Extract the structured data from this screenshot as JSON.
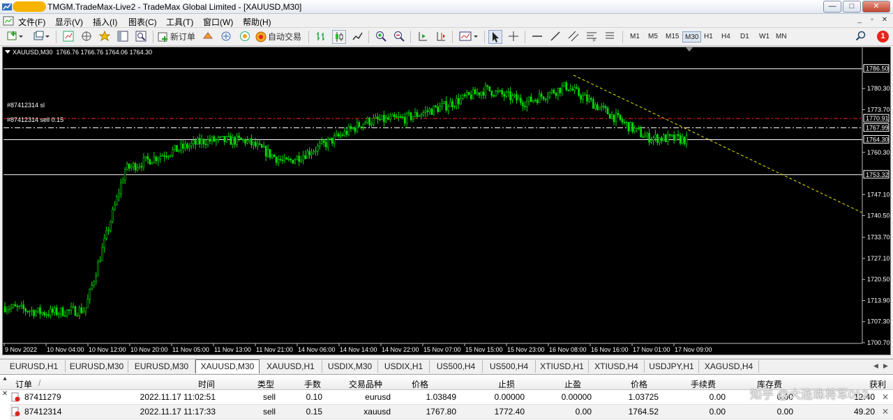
{
  "window": {
    "title": "TMGM.TradeMax-Live2 - TradeMax Global Limited - [XAUUSD,M30]",
    "controls": {
      "minimize": "—",
      "maximize": "□",
      "close": "✕"
    }
  },
  "menu": {
    "items": [
      "文件(F)",
      "显示(V)",
      "插入(I)",
      "图表(C)",
      "工具(T)",
      "窗口(W)",
      "帮助(H)"
    ],
    "mdi": {
      "minimize": "_",
      "restore": "▫",
      "close": "✕"
    }
  },
  "toolbar": {
    "new_order": "新订单",
    "auto_trade": "自动交易",
    "timeframes": [
      "M1",
      "M5",
      "M15",
      "M30",
      "H1",
      "H4",
      "D1",
      "W1",
      "MN"
    ],
    "active_timeframe": "M30",
    "notification_count": "1"
  },
  "chart": {
    "header": "XAUUSD,M30  1766.76 1766.76 1764.06 1764.30",
    "order_lines": [
      "#87412314 sl",
      "#87412314 sell 0.15"
    ],
    "price_labels": [
      "1786.50",
      "1770.91",
      "1767.99",
      "1764.30",
      "1753.32"
    ],
    "price_axis": [
      "1786.50",
      "1780.30",
      "1773.70",
      "1770.91",
      "1767.99",
      "1764.30",
      "1760.30",
      "1753.32",
      "1747.10",
      "1740.50",
      "1733.70",
      "1727.10",
      "1720.50",
      "1713.90",
      "1707.30",
      "1700.70"
    ],
    "time_axis": [
      "9 Nov 2022",
      "10 Nov 04:00",
      "10 Nov 12:00",
      "10 Nov 20:00",
      "11 Nov 05:00",
      "11 Nov 13:00",
      "11 Nov 21:00",
      "14 Nov 06:00",
      "14 Nov 14:00",
      "14 Nov 22:00",
      "15 Nov 07:00",
      "15 Nov 15:00",
      "15 Nov 23:00",
      "16 Nov 08:00",
      "16 Nov 16:00",
      "17 Nov 01:00",
      "17 Nov 09:00"
    ],
    "colors": {
      "candle": "#00dd00",
      "sl_line": "#ff2020",
      "trend_line": "#e6e600",
      "background": "#000000",
      "grid_text": "#ffffff"
    }
  },
  "chart_data": {
    "type": "line",
    "title": "XAUUSD,M30",
    "xlabel": "",
    "ylabel": "",
    "ylim": [
      1700.7,
      1789.5
    ],
    "x": [
      "9 Nov 2022",
      "10 Nov 04:00",
      "10 Nov 12:00",
      "10 Nov 20:00",
      "11 Nov 05:00",
      "11 Nov 13:00",
      "11 Nov 21:00",
      "14 Nov 06:00",
      "14 Nov 14:00",
      "14 Nov 22:00",
      "15 Nov 07:00",
      "15 Nov 15:00",
      "15 Nov 23:00",
      "16 Nov 08:00",
      "16 Nov 16:00",
      "17 Nov 01:00",
      "17 Nov 09:00"
    ],
    "series": [
      {
        "name": "XAUUSD,M30",
        "values": [
          1712,
          1710,
          1711,
          1755,
          1760,
          1764,
          1764,
          1757,
          1763,
          1770,
          1771,
          1775,
          1780,
          1776,
          1781,
          1773,
          1765,
          1764.3
        ]
      }
    ],
    "hlines": [
      1786.5,
      1770.91,
      1767.99,
      1764.3,
      1753.32
    ]
  },
  "symbol_tabs": {
    "items": [
      "EURUSD,H1",
      "EURUSD,M30",
      "EURUSD,M30",
      "XAUUSD,M30",
      "XAUUSD,H1",
      "USDIX,M30",
      "USDIX,H1",
      "US500,H4",
      "US500,H4",
      "XTIUSD,H1",
      "XTIUSD,H4",
      "USDJPY,H1",
      "XAGUSD,H4"
    ],
    "active_index": 3
  },
  "terminal": {
    "headers": [
      "订单",
      "/",
      "时间",
      "类型",
      "手数",
      "交易品种",
      "价格",
      "止损",
      "止盈",
      "价格",
      "手续费",
      "库存费",
      "获利"
    ],
    "rows": [
      [
        "87411279",
        "2022.11.17 11:02:51",
        "sell",
        "0.10",
        "eurusd",
        "1.03849",
        "0.00000",
        "0.00000",
        "1.03725",
        "0.00",
        "0.00",
        "12.40"
      ],
      [
        "87412314",
        "2022.11.17 11:17:33",
        "sell",
        "0.15",
        "xauusd",
        "1767.80",
        "1772.40",
        "0.00",
        "1764.52",
        "0.00",
        "0.00",
        "49.20"
      ]
    ],
    "watermark": "知乎 @大连珠将军012"
  }
}
